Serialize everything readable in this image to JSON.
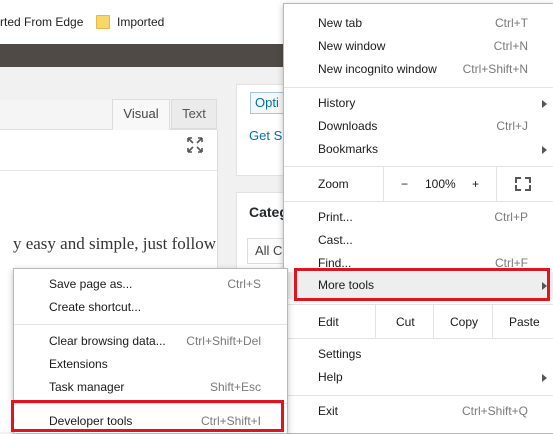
{
  "bookmarks": {
    "edge_item": "rted From Edge",
    "imported": "Imported"
  },
  "editor": {
    "tab_visual": "Visual",
    "tab_text": "Text",
    "body_text": "y easy and simple, just follow"
  },
  "sidebar": {
    "options_button": "Opti",
    "get_link": "Get S",
    "categories_title": "Categ",
    "all_categories_tab": "All C"
  },
  "main_menu": {
    "new_tab": {
      "label": "New tab",
      "shortcut": "Ctrl+T"
    },
    "new_window": {
      "label": "New window",
      "shortcut": "Ctrl+N"
    },
    "new_incognito": {
      "label": "New incognito window",
      "shortcut": "Ctrl+Shift+N"
    },
    "history": {
      "label": "History"
    },
    "downloads": {
      "label": "Downloads",
      "shortcut": "Ctrl+J"
    },
    "bookmarks": {
      "label": "Bookmarks"
    },
    "zoom": {
      "label": "Zoom",
      "minus": "−",
      "level": "100%",
      "plus": "+"
    },
    "print": {
      "label": "Print...",
      "shortcut": "Ctrl+P"
    },
    "cast": {
      "label": "Cast..."
    },
    "find": {
      "label": "Find...",
      "shortcut": "Ctrl+F"
    },
    "more_tools": {
      "label": "More tools"
    },
    "edit": {
      "label": "Edit",
      "cut": "Cut",
      "copy": "Copy",
      "paste": "Paste"
    },
    "settings": {
      "label": "Settings"
    },
    "help": {
      "label": "Help"
    },
    "exit": {
      "label": "Exit",
      "shortcut": "Ctrl+Shift+Q"
    }
  },
  "sub_menu": {
    "save_page": {
      "label": "Save page as...",
      "shortcut": "Ctrl+S"
    },
    "create_shortcut": {
      "label": "Create shortcut..."
    },
    "clear_browsing": {
      "label": "Clear browsing data...",
      "shortcut": "Ctrl+Shift+Del"
    },
    "extensions": {
      "label": "Extensions"
    },
    "task_manager": {
      "label": "Task manager",
      "shortcut": "Shift+Esc"
    },
    "developer_tools": {
      "label": "Developer tools",
      "shortcut": "Ctrl+Shift+I"
    }
  },
  "colors": {
    "highlight": "#e0141e",
    "menu_bg": "#ffffff",
    "hover_bg": "#eeeeee"
  }
}
